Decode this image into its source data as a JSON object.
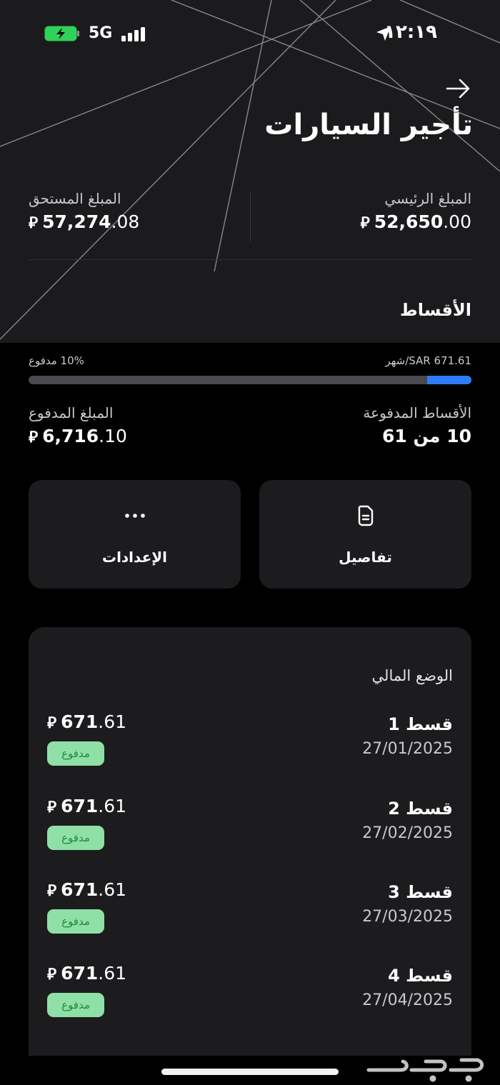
{
  "status_bar": {
    "time": "١٢:١٩",
    "network": "5G"
  },
  "header": {
    "title": "تأجير السيارات"
  },
  "summary": {
    "principal": {
      "label": "المبلغ الرئيسي",
      "int": "52,650",
      "dec": ".00",
      "currency": "⃁"
    },
    "due": {
      "label": "المبلغ المستحق",
      "int": "57,274",
      "dec": ".08",
      "currency": "⃁"
    }
  },
  "installments": {
    "title": "الأقساط",
    "monthly_label": "SAR 671.61/شهر",
    "percent_label": "10% مدفوع",
    "progress_fraction": 0.1,
    "paid_count": {
      "label": "الأقساط المدفوعة",
      "value": "10 من 61"
    },
    "paid_amount": {
      "label": "المبلغ المدفوع",
      "int": "6,716",
      "dec": ".10",
      "currency": "⃁"
    }
  },
  "actions": {
    "details_label": "تفاصيل",
    "settings_label": "الإعدادات"
  },
  "financial": {
    "title": "الوضع المالي",
    "items": [
      {
        "name": "قسط 1",
        "date": "27/01/2025",
        "int": "671",
        "dec": ".61",
        "currency": "⃁",
        "status": "مدفوع"
      },
      {
        "name": "قسط 2",
        "date": "27/02/2025",
        "int": "671",
        "dec": ".61",
        "currency": "⃁",
        "status": "مدفوع"
      },
      {
        "name": "قسط 3",
        "date": "27/03/2025",
        "int": "671",
        "dec": ".61",
        "currency": "⃁",
        "status": "مدفوع"
      },
      {
        "name": "قسط 4",
        "date": "27/04/2025",
        "int": "671",
        "dec": ".61",
        "currency": "⃁",
        "status": "مدفوع"
      }
    ]
  },
  "watermark": "حراج",
  "colors": {
    "accent": "#2f7cf6",
    "badge_bg": "#8fe0a6",
    "badge_text": "#1f8a3a",
    "card_bg": "#1c1c1e"
  }
}
